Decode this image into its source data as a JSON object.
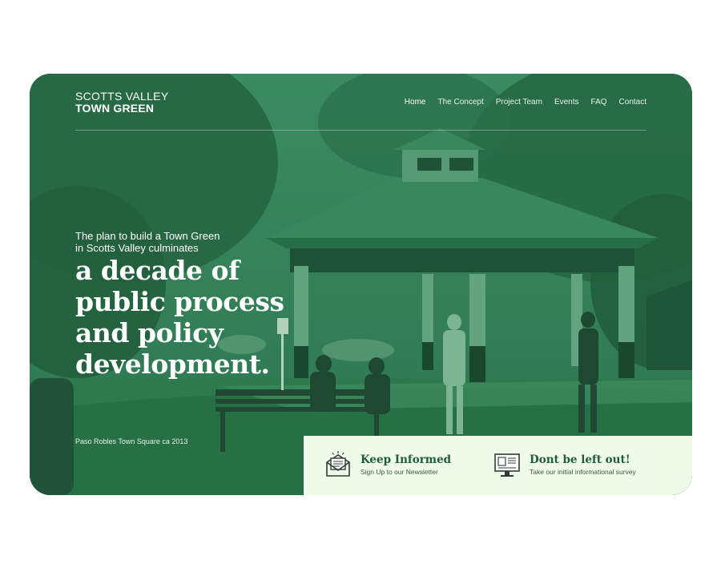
{
  "brand": {
    "line1": "SCOTTS VALLEY",
    "line2": "TOWN GREEN"
  },
  "nav": {
    "items": [
      {
        "label": "Home"
      },
      {
        "label": "The Concept"
      },
      {
        "label": "Project Team"
      },
      {
        "label": "Events"
      },
      {
        "label": "FAQ"
      },
      {
        "label": "Contact"
      }
    ]
  },
  "hero": {
    "intro_line1": "The plan to build a Town Green",
    "intro_line2": "in Scotts Valley culminates",
    "title_line1": "a decade of",
    "title_line2": "public process",
    "title_line3": "and policy",
    "title_line4": "development.",
    "caption": "Paso Robles Town Square ca 2013"
  },
  "cta": {
    "newsletter": {
      "title": "Keep Informed",
      "subtitle": "Sign Up to our Newsletter",
      "icon": "envelope-newsletter-icon"
    },
    "survey": {
      "title": "Dont be left out!",
      "subtitle": "Take our initial informational survey",
      "icon": "computer-survey-icon"
    }
  },
  "colors": {
    "overlay": "#2f7a52",
    "cta_bg": "#effbe8",
    "cta_title": "#1e5c3c"
  }
}
